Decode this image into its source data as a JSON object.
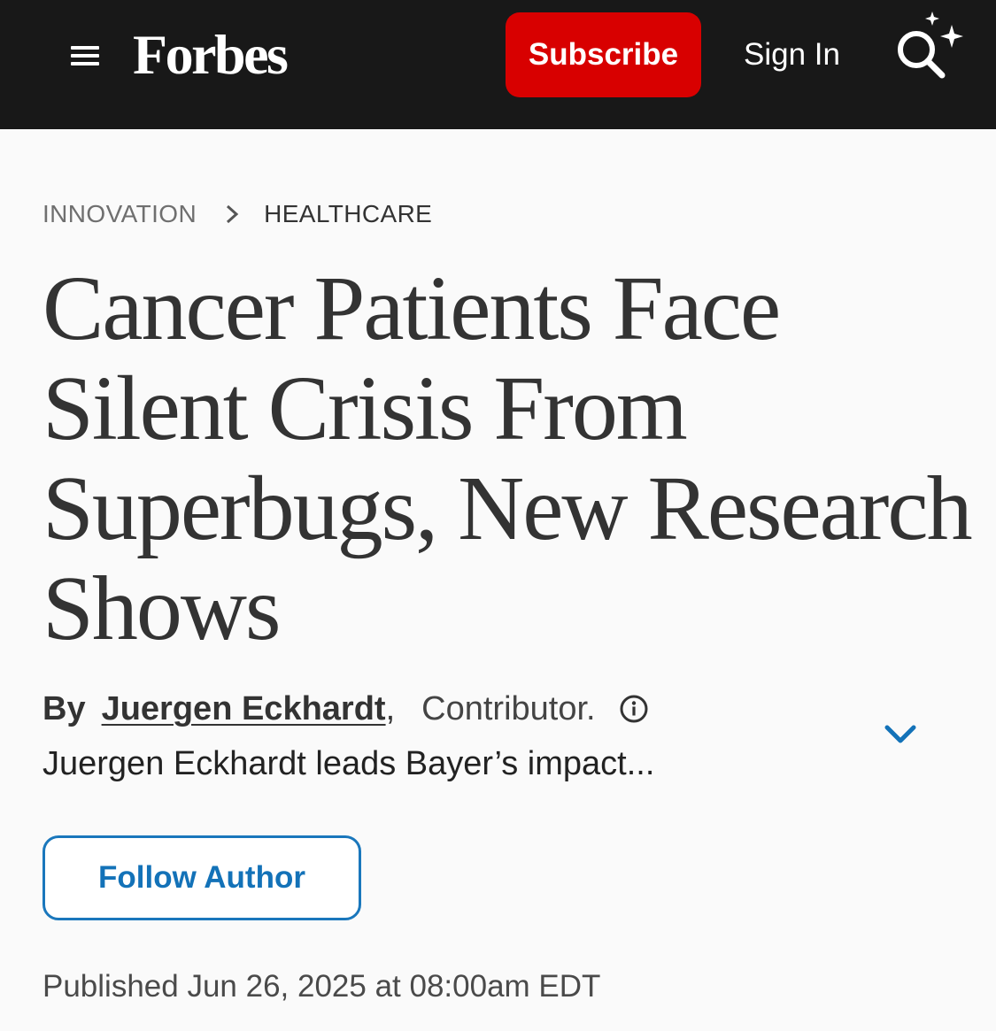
{
  "header": {
    "logo_text": "Forbes",
    "subscribe_label": "Subscribe",
    "signin_label": "Sign In"
  },
  "breadcrumb": {
    "section": "INNOVATION",
    "subsection": "HEALTHCARE"
  },
  "article": {
    "headline": "Cancer Patients Face Silent Crisis From Superbugs, New Research Shows",
    "byline": {
      "by_label": "By",
      "author_name": "Juergen Eckhardt",
      "comma": ",",
      "role": "Contributor.",
      "bio": "Juergen Eckhardt leads Bayer’s impact..."
    },
    "follow_label": "Follow Author",
    "published": "Published Jun 26, 2025 at 08:00am EDT"
  },
  "colors": {
    "header_bg": "#181818",
    "subscribe_bg": "#d80000",
    "link_blue": "#1372b8",
    "text_dark": "#333333"
  },
  "icons": {
    "menu": "hamburger-menu-icon",
    "search": "sparkle-search-icon",
    "breadcrumb_separator": "chevron-right-icon",
    "info": "info-circle-icon",
    "expand": "chevron-down-icon"
  }
}
